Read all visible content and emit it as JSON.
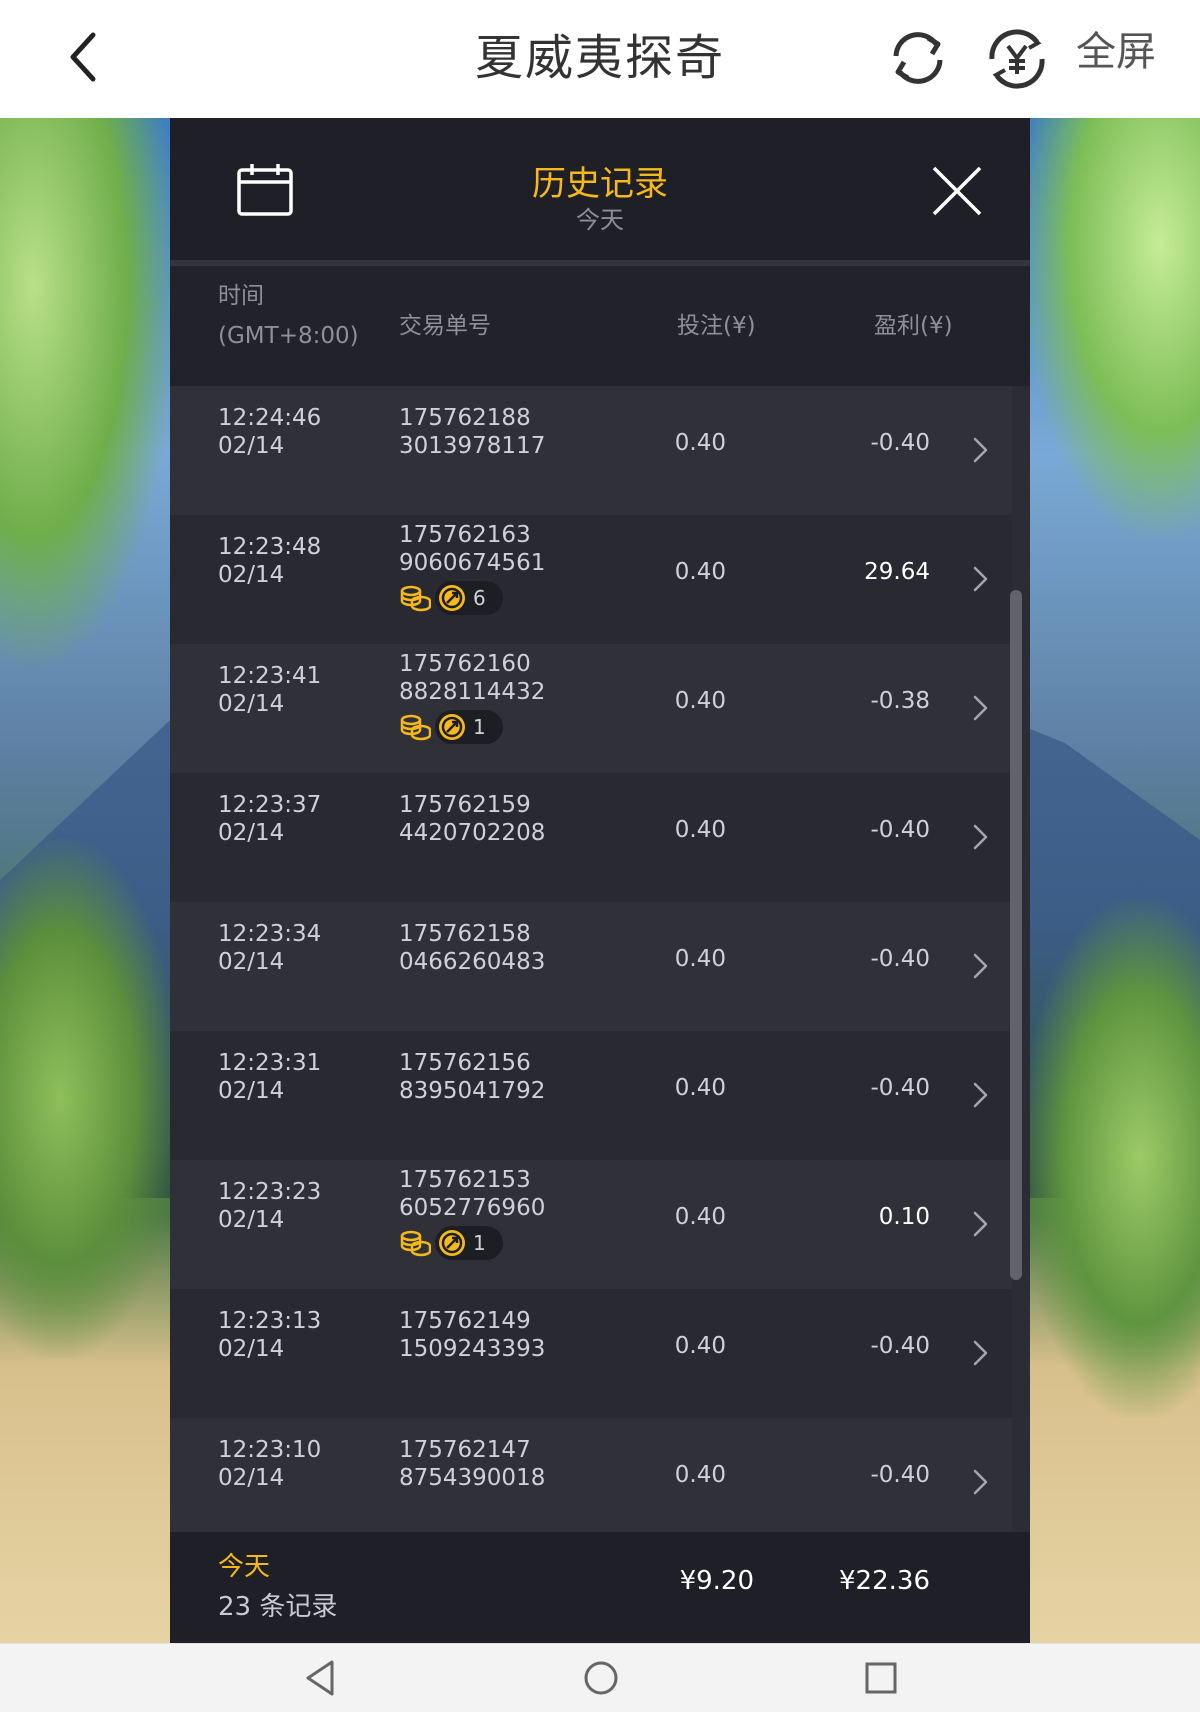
{
  "app": {
    "title": "夏威夷探奇",
    "fullscreen_label": "全屏",
    "icons": {
      "back": "chevron-left-icon",
      "refresh": "refresh-icon",
      "currency": "currency-yen-icon"
    }
  },
  "panel": {
    "title": "历史记录",
    "subtitle": "今天",
    "accent_color": "#f6b81b",
    "columns": {
      "time_label": "时间",
      "time_zone": "(GMT+8:00)",
      "tx_label": "交易单号",
      "bet_label": "投注(¥)",
      "profit_label": "盈利(¥)"
    },
    "rows": [
      {
        "time": "12:24:46",
        "date": "02/14",
        "tx1": "175762188",
        "tx2": "3013978117",
        "bet": "0.40",
        "profit": "-0.40",
        "win": false,
        "badge": null
      },
      {
        "time": "12:23:48",
        "date": "02/14",
        "tx1": "175762163",
        "tx2": "9060674561",
        "bet": "0.40",
        "profit": "29.64",
        "win": true,
        "badge": "6"
      },
      {
        "time": "12:23:41",
        "date": "02/14",
        "tx1": "175762160",
        "tx2": "8828114432",
        "bet": "0.40",
        "profit": "-0.38",
        "win": false,
        "badge": "1"
      },
      {
        "time": "12:23:37",
        "date": "02/14",
        "tx1": "175762159",
        "tx2": "4420702208",
        "bet": "0.40",
        "profit": "-0.40",
        "win": false,
        "badge": null
      },
      {
        "time": "12:23:34",
        "date": "02/14",
        "tx1": "175762158",
        "tx2": "0466260483",
        "bet": "0.40",
        "profit": "-0.40",
        "win": false,
        "badge": null
      },
      {
        "time": "12:23:31",
        "date": "02/14",
        "tx1": "175762156",
        "tx2": "8395041792",
        "bet": "0.40",
        "profit": "-0.40",
        "win": false,
        "badge": null
      },
      {
        "time": "12:23:23",
        "date": "02/14",
        "tx1": "175762153",
        "tx2": "6052776960",
        "bet": "0.40",
        "profit": "0.10",
        "win": true,
        "badge": "1"
      },
      {
        "time": "12:23:13",
        "date": "02/14",
        "tx1": "175762149",
        "tx2": "1509243393",
        "bet": "0.40",
        "profit": "-0.40",
        "win": false,
        "badge": null
      },
      {
        "time": "12:23:10",
        "date": "02/14",
        "tx1": "175762147",
        "tx2": "8754390018",
        "bet": "0.40",
        "profit": "-0.40",
        "win": false,
        "badge": null
      }
    ],
    "footer": {
      "period": "今天",
      "count": "23 条记录",
      "total_bet": "¥9.20",
      "total_profit": "¥22.36"
    }
  }
}
